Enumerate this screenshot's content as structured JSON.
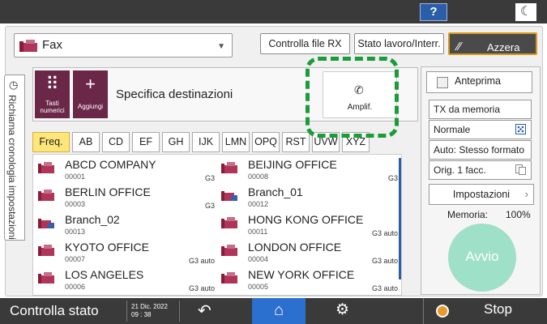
{
  "header": {
    "help": "?",
    "theme_icon": "moon-icon"
  },
  "function_select": {
    "value": "Fax"
  },
  "top_buttons": {
    "rx_control": "Controlla file RX",
    "job_status": "Stato lavoro/Interr.",
    "reset": "Azzera"
  },
  "history_tab": {
    "label": "Richiama cronologia impostazioni"
  },
  "destination": {
    "keypad_label": "Tasti numerici",
    "add_label": "Aggiungi",
    "label": "Specifica destinazioni",
    "amplif_label": "Amplif."
  },
  "tabs": [
    "Freq.",
    "AB",
    "CD",
    "EF",
    "GH",
    "IJK",
    "LMN",
    "OPQ",
    "RST",
    "UVW",
    "XYZ"
  ],
  "entries": [
    {
      "name": "ABCD COMPANY",
      "num": "00001",
      "mode": "G3",
      "group": false
    },
    {
      "name": "BEIJING OFFICE",
      "num": "00008",
      "mode": "G3",
      "group": false
    },
    {
      "name": "BERLIN OFFICE",
      "num": "00003",
      "mode": "G3",
      "group": false
    },
    {
      "name": "Branch_01",
      "num": "00012",
      "mode": "",
      "group": true
    },
    {
      "name": "Branch_02",
      "num": "00013",
      "mode": "",
      "group": true
    },
    {
      "name": "HONG KONG OFFICE",
      "num": "00011",
      "mode": "G3 auto",
      "group": false
    },
    {
      "name": "KYOTO OFFICE",
      "num": "00007",
      "mode": "G3 auto",
      "group": false
    },
    {
      "name": "LONDON OFFICE",
      "num": "00004",
      "mode": "G3 auto",
      "group": false
    },
    {
      "name": "LOS ANGELES",
      "num": "00006",
      "mode": "G3 auto",
      "group": false
    },
    {
      "name": "NEW YORK OFFICE",
      "num": "00005",
      "mode": "G3 auto",
      "group": false
    }
  ],
  "options": {
    "preview": "Anteprima",
    "tx_memory": "TX da memoria",
    "resolution": "Normale",
    "size": "Auto: Stesso formato",
    "duplex": "Orig. 1 facc.",
    "settings": "Impostazioni",
    "memory_label": "Memoria:",
    "memory_value": "100%",
    "start": "Avvio"
  },
  "bottom": {
    "status": "Controlla stato",
    "date": "21 Dic. 2022",
    "time": "09 : 38",
    "stop": "Stop"
  },
  "colors": {
    "accent_green": "#1b9c3a",
    "tab_active": "#ffe67a",
    "home_blue": "#2b6fcf",
    "purple": "#6a2748"
  }
}
